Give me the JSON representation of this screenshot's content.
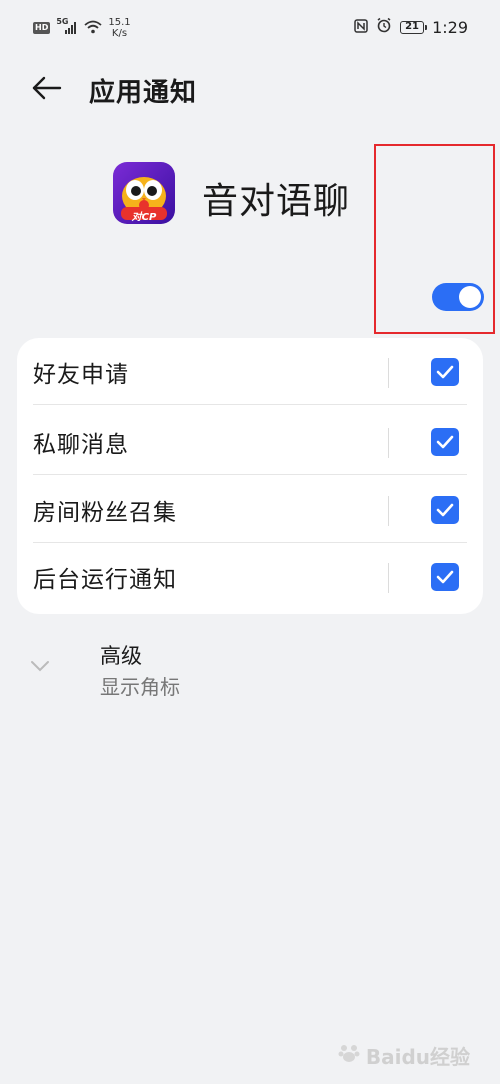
{
  "status_bar": {
    "hd_label": "HD",
    "network_label": "5G",
    "speed_value": "15.1",
    "speed_unit": "K/s",
    "battery": "21",
    "time": "1:29"
  },
  "header": {
    "title": "应用通知"
  },
  "app": {
    "name": "音对语聊",
    "icon_badge": "对CP",
    "notifications_enabled": true
  },
  "settings": {
    "items": [
      {
        "label": "好友申请",
        "checked": true
      },
      {
        "label": "私聊消息",
        "checked": true
      },
      {
        "label": "房间粉丝召集",
        "checked": true
      },
      {
        "label": "后台运行通知",
        "checked": true
      }
    ]
  },
  "advanced": {
    "title": "高级",
    "subtitle": "显示角标"
  },
  "watermark": {
    "text": "Baidu经验"
  },
  "colors": {
    "accent": "#2b6ef5",
    "highlight": "#e5292d",
    "background": "#f1f2f4"
  }
}
